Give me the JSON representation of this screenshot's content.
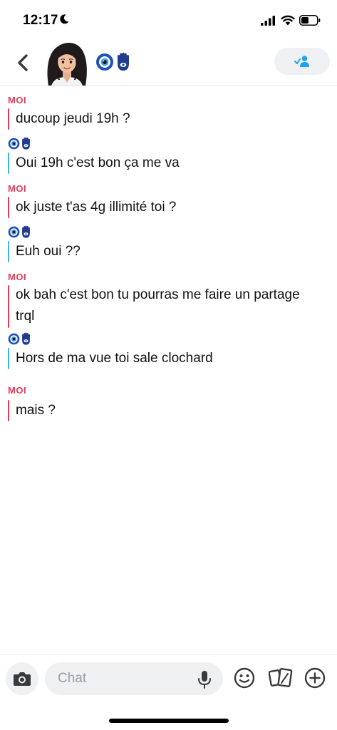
{
  "status_bar": {
    "time": "12:17"
  },
  "header": {
    "contact_name_emoji_1": "evil-eye-emoji",
    "contact_name_emoji_2": "hamsa-emoji",
    "back_icon": "chevron-left-icon",
    "add_friend_icon": "add-friend-check-icon"
  },
  "conversation": {
    "messages": [
      {
        "sender": "me",
        "label": "MOI",
        "text": "ducoup jeudi 19h ?"
      },
      {
        "sender": "them",
        "text": "Oui 19h c'est bon ça me va"
      },
      {
        "sender": "me",
        "label": "MOI",
        "text": "ok juste t'as 4g illimité toi ?"
      },
      {
        "sender": "them",
        "text": "Euh oui ??"
      },
      {
        "sender": "me",
        "label": "MOI",
        "text": "ok bah c'est bon tu pourras me faire un partage trql"
      },
      {
        "sender": "them",
        "text": "Hors de ma vue toi sale clochard"
      },
      {
        "sender": "me",
        "label": "MOI",
        "text": "mais ?"
      }
    ]
  },
  "composer": {
    "placeholder": "Chat",
    "value": ""
  },
  "colors": {
    "me_accent": "#e03c5a",
    "them_accent": "#3eb3ee",
    "friend_icon": "#1da1f2"
  }
}
